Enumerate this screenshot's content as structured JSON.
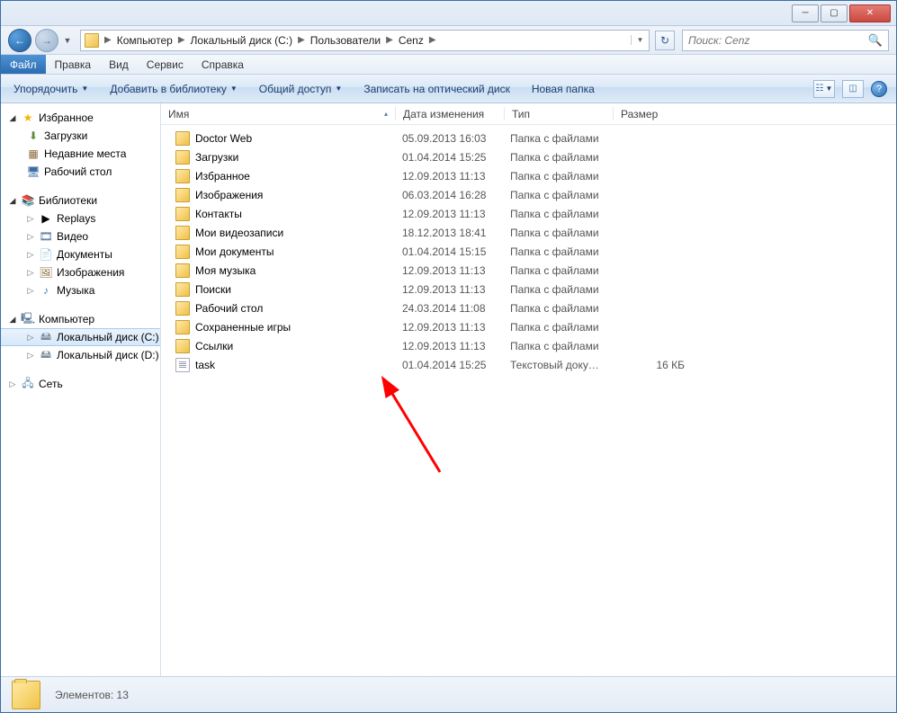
{
  "breadcrumb": [
    "Компьютер",
    "Локальный диск (C:)",
    "Пользователи",
    "Cenz"
  ],
  "search_placeholder": "Поиск: Cenz",
  "menubar": [
    "Файл",
    "Правка",
    "Вид",
    "Сервис",
    "Справка"
  ],
  "toolbar": {
    "organize": "Упорядочить",
    "add_lib": "Добавить в библиотеку",
    "share": "Общий доступ",
    "burn": "Записать на оптический диск",
    "new_folder": "Новая папка"
  },
  "columns": {
    "name": "Имя",
    "date": "Дата изменения",
    "type": "Тип",
    "size": "Размер"
  },
  "sidebar": {
    "favorites": {
      "label": "Избранное",
      "items": [
        "Загрузки",
        "Недавние места",
        "Рабочий стол"
      ]
    },
    "libraries": {
      "label": "Библиотеки",
      "items": [
        "Replays",
        "Видео",
        "Документы",
        "Изображения",
        "Музыка"
      ]
    },
    "computer": {
      "label": "Компьютер",
      "items": [
        "Локальный диск (C:)",
        "Локальный диск (D:)"
      ]
    },
    "network": {
      "label": "Сеть"
    }
  },
  "files": [
    {
      "name": "Doctor Web",
      "date": "05.09.2013 16:03",
      "type": "Папка с файлами",
      "size": "",
      "icon": "folder"
    },
    {
      "name": "Загрузки",
      "date": "01.04.2014 15:25",
      "type": "Папка с файлами",
      "size": "",
      "icon": "folder"
    },
    {
      "name": "Избранное",
      "date": "12.09.2013 11:13",
      "type": "Папка с файлами",
      "size": "",
      "icon": "folder"
    },
    {
      "name": "Изображения",
      "date": "06.03.2014 16:28",
      "type": "Папка с файлами",
      "size": "",
      "icon": "folder"
    },
    {
      "name": "Контакты",
      "date": "12.09.2013 11:13",
      "type": "Папка с файлами",
      "size": "",
      "icon": "folder"
    },
    {
      "name": "Мои видеозаписи",
      "date": "18.12.2013 18:41",
      "type": "Папка с файлами",
      "size": "",
      "icon": "folder"
    },
    {
      "name": "Мои документы",
      "date": "01.04.2014 15:15",
      "type": "Папка с файлами",
      "size": "",
      "icon": "folder"
    },
    {
      "name": "Моя музыка",
      "date": "12.09.2013 11:13",
      "type": "Папка с файлами",
      "size": "",
      "icon": "folder"
    },
    {
      "name": "Поиски",
      "date": "12.09.2013 11:13",
      "type": "Папка с файлами",
      "size": "",
      "icon": "folder"
    },
    {
      "name": "Рабочий стол",
      "date": "24.03.2014 11:08",
      "type": "Папка с файлами",
      "size": "",
      "icon": "folder"
    },
    {
      "name": "Сохраненные игры",
      "date": "12.09.2013 11:13",
      "type": "Папка с файлами",
      "size": "",
      "icon": "folder"
    },
    {
      "name": "Ссылки",
      "date": "12.09.2013 11:13",
      "type": "Папка с файлами",
      "size": "",
      "icon": "folder"
    },
    {
      "name": "task",
      "date": "01.04.2014 15:25",
      "type": "Текстовый докум...",
      "size": "16 КБ",
      "icon": "file"
    }
  ],
  "details": {
    "items_label": "Элементов: 13"
  }
}
